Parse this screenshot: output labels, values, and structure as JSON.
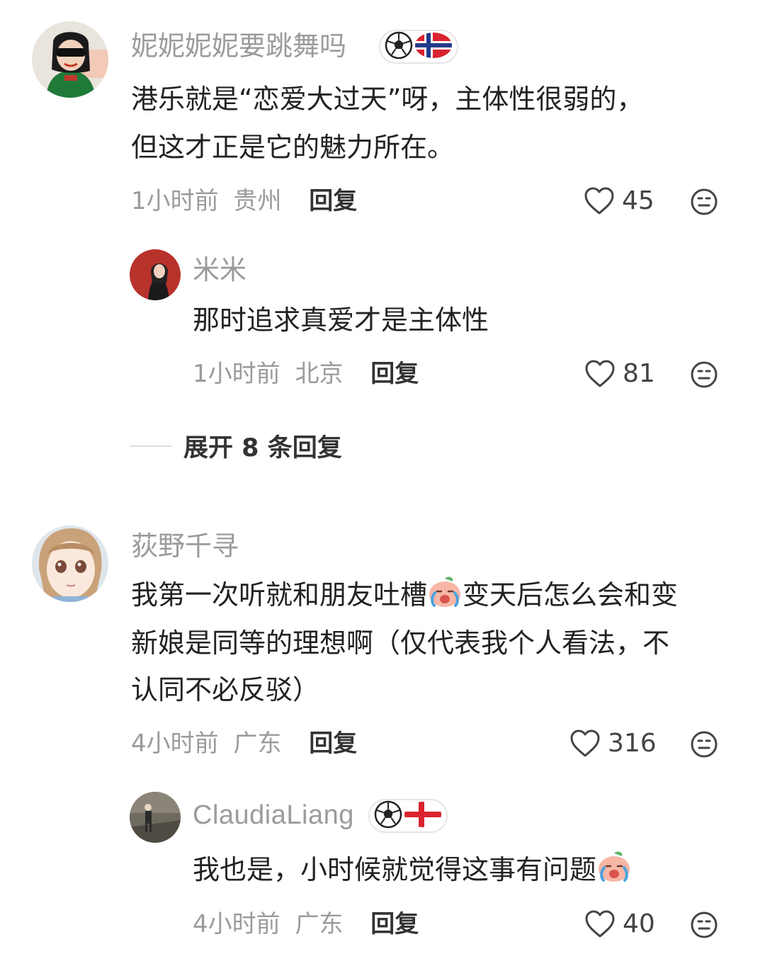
{
  "comments": [
    {
      "username": "妮妮妮妮要跳舞吗",
      "badge_icons": [
        "soccer-ball-icon",
        "norway-flag-icon"
      ],
      "text_lines": [
        "港乐就是“恋爱大过天”呀，主体性很弱的，",
        "但这才正是它的魅力所在。"
      ],
      "time": "1小时前",
      "location": "贵州",
      "reply_label": "回复",
      "likes": "45",
      "replies": [
        {
          "username": "米米",
          "text_lines": [
            "那时追求真爱才是主体性"
          ],
          "time": "1小时前",
          "location": "北京",
          "reply_label": "回复",
          "likes": "81"
        }
      ],
      "expand_label": "展开 8 条回复"
    },
    {
      "username": "荻野千寻",
      "text_lines": [
        "我第一次听就和朋友吐槽",
        "变天后怎么会和变",
        "新娘是同等的理想啊（仅代表我个人看法，不",
        "认同不必反驳）"
      ],
      "time": "4小时前",
      "location": "广东",
      "reply_label": "回复",
      "likes": "316",
      "replies": [
        {
          "username": "ClaudiaLiang",
          "badge_icons": [
            "soccer-ball-icon",
            "england-flag-icon"
          ],
          "text_lines": [
            "我也是，小时候就觉得这事有问题"
          ],
          "time": "4小时前",
          "location": "广东",
          "reply_label": "回复",
          "likes": "40"
        }
      ]
    }
  ],
  "icons": {
    "like": "heart-outline-icon",
    "emoji_reaction": "neutral-face-icon",
    "inline_emoji": "crying-peach-emoji-icon"
  },
  "colors": {
    "username": "#9b9b9b",
    "body_text": "#222222",
    "meta_text": "#9b9b9b",
    "reply_label": "#333333"
  }
}
